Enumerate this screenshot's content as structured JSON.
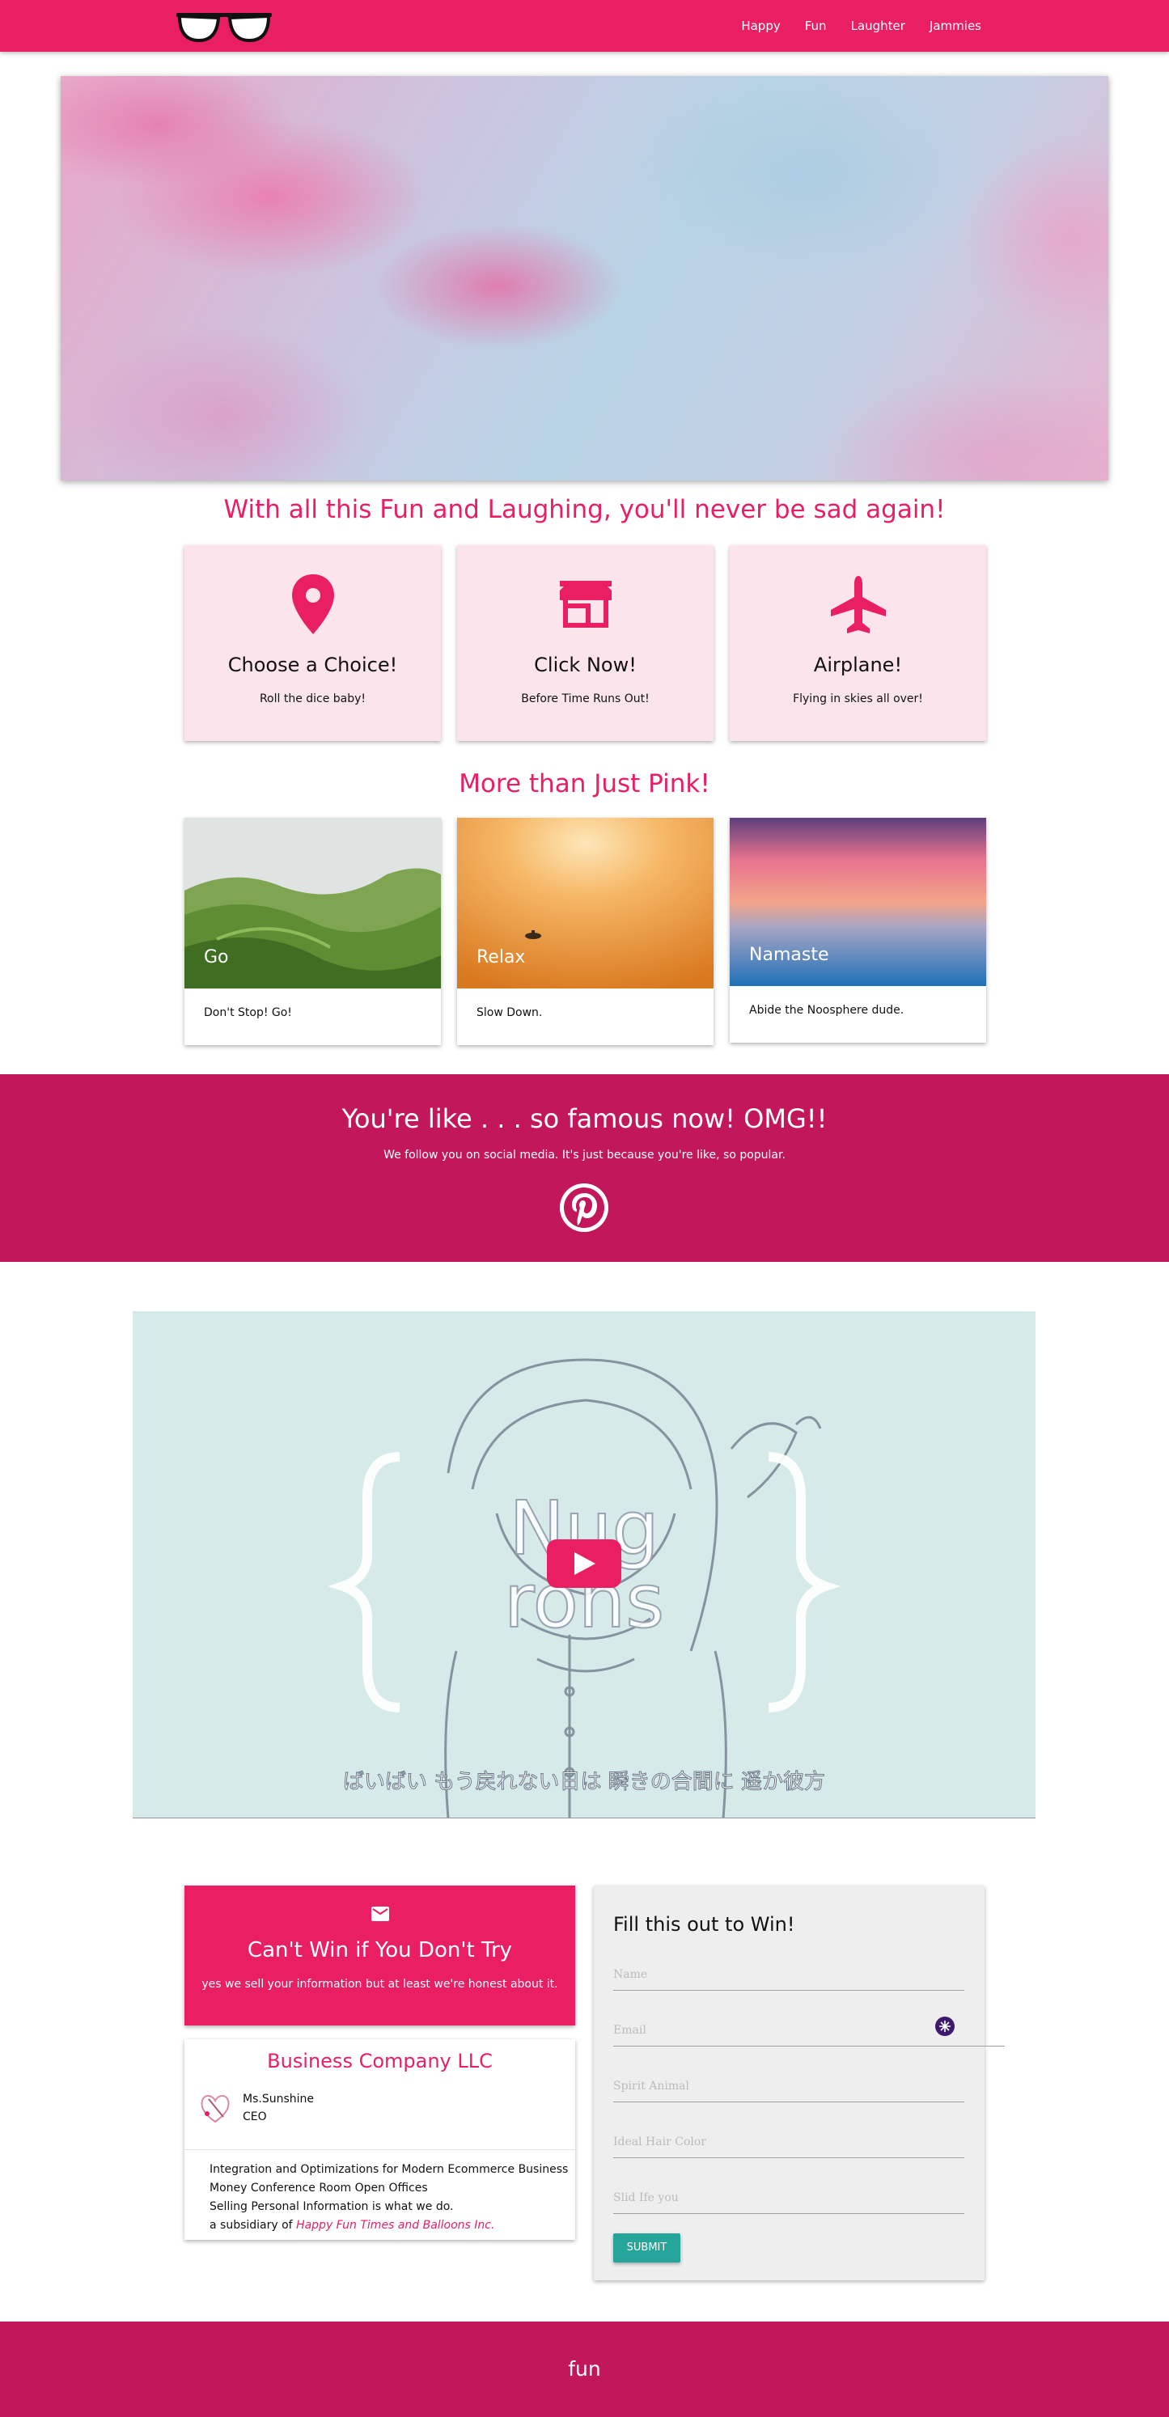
{
  "nav": {
    "links": [
      "Happy",
      "Fun",
      "Laughter",
      "Jammies"
    ],
    "logo_icon": "glasses-logo"
  },
  "headings": {
    "fun_title": "With all this Fun and Laughing, you'll never be sad again!",
    "pink_title": "More than Just Pink!"
  },
  "features": [
    {
      "icon": "map-pin-icon",
      "title": "Choose a Choice!",
      "subtitle": "Roll the dice baby!"
    },
    {
      "icon": "store-icon",
      "title": "Click Now!",
      "subtitle": "Before Time Runs Out!"
    },
    {
      "icon": "airplane-icon",
      "title": "Airplane!",
      "subtitle": "Flying in skies all over!"
    }
  ],
  "image_cards": [
    {
      "label": "Go",
      "text": "Don't Stop! Go!"
    },
    {
      "label": "Relax",
      "text": "Slow Down."
    },
    {
      "label": "Namaste",
      "text": "Abide the Noosphere dude."
    }
  ],
  "social": {
    "title": "You're like . . . so famous now! OMG!!",
    "subtitle": "We follow you on social media. It's just because you're like, so popular.",
    "icon": "pinterest-icon"
  },
  "video": {
    "logo_top": "Nug",
    "logo_bottom": "rons",
    "caption": "ばいばい もう戻れない日は 瞬きの合間に 遥か彼方",
    "play_icon": "play-icon"
  },
  "promo": {
    "icon": "mail-icon",
    "title": "Can't Win if You Don't Try",
    "subtitle": "yes we sell your information but at least we're honest about it."
  },
  "business": {
    "name": "Business Company LLC",
    "person_name": "Ms.Sunshine",
    "person_role": "CEO",
    "lines": [
      "Integration and Optimizations for Modern Ecommerce Business",
      "Money Conference Room Open Offices",
      "Selling Personal Information is what we do."
    ],
    "subsidiary_prefix": "a subsidiary of",
    "subsidiary_name": "Happy Fun Times and Balloons Inc."
  },
  "form": {
    "title": "Fill this out to Win!",
    "placeholders": [
      "Name",
      "Email",
      "Spirit Animal",
      "Ideal Hair Color",
      "Slid Ife you"
    ],
    "submit_label": "SUBMIT"
  },
  "footer": {
    "text": "fun"
  },
  "colors": {
    "primary": "#e91e63",
    "dark_primary": "#c2185b",
    "card_pink": "#fce4ec",
    "teal": "#26a69a"
  }
}
